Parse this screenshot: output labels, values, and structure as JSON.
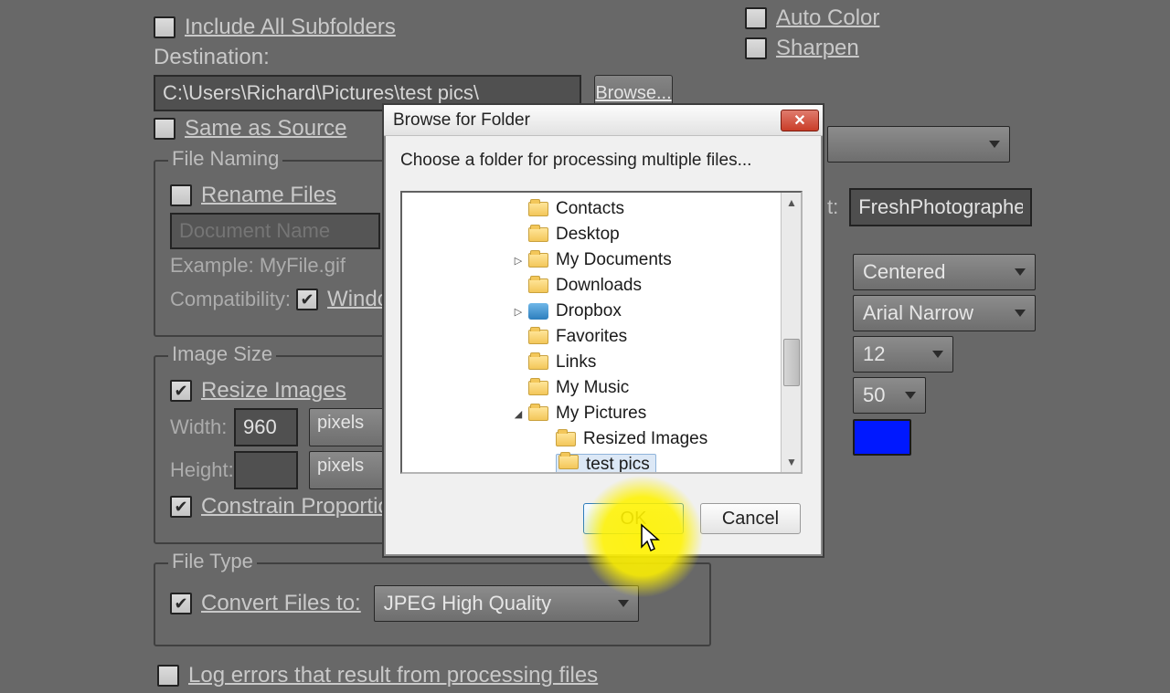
{
  "left": {
    "include_subfolders": "Include All Subfolders",
    "destination_label": "Destination:",
    "destination_path": "C:\\Users\\Richard\\Pictures\\test pics\\",
    "browse": "Browse...",
    "same_as_source": "Same as Source",
    "file_naming": {
      "legend": "File Naming",
      "rename_files": "Rename Files",
      "doc_name_placeholder": "Document Name",
      "example": "Example: MyFile.gif",
      "compat": "Compatibility:",
      "windows": "Windows"
    },
    "image_size": {
      "legend": "Image Size",
      "resize": "Resize Images",
      "width_label": "Width:",
      "width_val": "960",
      "height_label": "Height:",
      "height_val": "",
      "units": "pixels",
      "constrain": "Constrain Proportions"
    },
    "file_type": {
      "legend": "File Type",
      "convert": "Convert Files to:",
      "format": "JPEG High Quality"
    },
    "log_errors": "Log errors that result from processing files"
  },
  "right": {
    "auto_color": "Auto Color",
    "sharpen": "Sharpen",
    "text_value": "FreshPhotographer.com",
    "position": "Centered",
    "font": "Arial Narrow",
    "size": "12",
    "opacity": "50",
    "swatch": "#0018ff"
  },
  "dialog": {
    "title": "Browse for Folder",
    "message": "Choose a folder for processing multiple files...",
    "ok": "OK",
    "cancel": "Cancel",
    "folders": [
      {
        "name": "Contacts",
        "depth": 150,
        "expander": ""
      },
      {
        "name": "Desktop",
        "depth": 150,
        "expander": ""
      },
      {
        "name": "My Documents",
        "depth": 150,
        "expander": "▷"
      },
      {
        "name": "Downloads",
        "depth": 150,
        "expander": ""
      },
      {
        "name": "Dropbox",
        "depth": 150,
        "expander": "▷",
        "icon": "dropbox"
      },
      {
        "name": "Favorites",
        "depth": 150,
        "expander": ""
      },
      {
        "name": "Links",
        "depth": 150,
        "expander": ""
      },
      {
        "name": "My Music",
        "depth": 150,
        "expander": ""
      },
      {
        "name": "My Pictures",
        "depth": 150,
        "expander": "◢"
      },
      {
        "name": "Resized Images",
        "depth": 180,
        "expander": ""
      },
      {
        "name": "test pics",
        "depth": 180,
        "expander": "",
        "selected": true
      }
    ]
  }
}
